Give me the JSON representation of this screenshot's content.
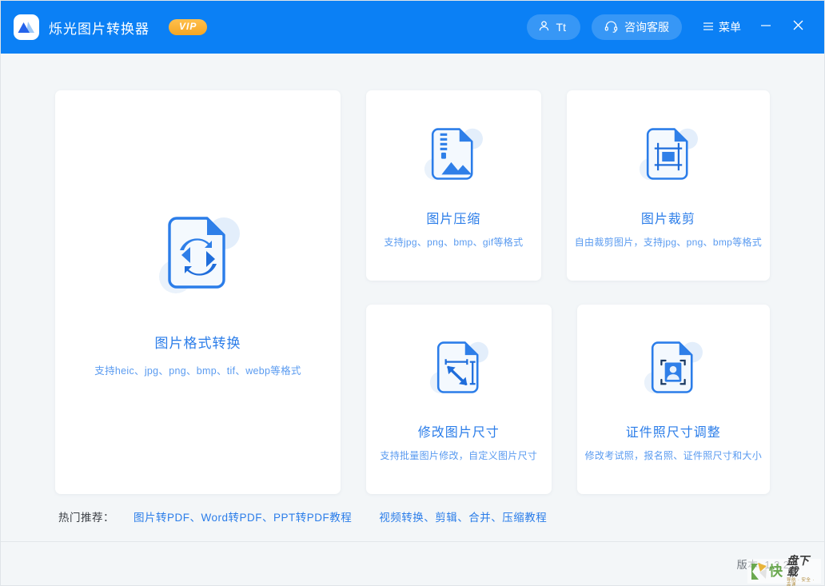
{
  "window": {
    "app_title": "烁光图片转换器",
    "badge": "VIP",
    "logo_icon": "mountain-logo-icon"
  },
  "header": {
    "user_label": "Tt",
    "user_icon": "user-icon",
    "support_label": "咨询客服",
    "support_icon": "headset-icon",
    "menu_label": "菜单",
    "menu_icon": "hamburger-icon",
    "minimize_icon": "minimize-icon",
    "close_icon": "close-icon"
  },
  "main": {
    "featured": {
      "title": "图片格式转换",
      "subtitle": "支持heic、jpg、png、bmp、tif、webp等格式",
      "icon": "image-format-convert-icon"
    },
    "cards": [
      {
        "title": "图片压缩",
        "subtitle": "支持jpg、png、bmp、gif等格式",
        "icon": "image-compress-icon"
      },
      {
        "title": "图片裁剪",
        "subtitle": "自由裁剪图片，支持jpg、png、bmp等格式",
        "icon": "image-crop-icon"
      },
      {
        "title": "修改图片尺寸",
        "subtitle": "支持批量图片修改，自定义图片尺寸",
        "icon": "image-resize-icon"
      },
      {
        "title": "证件照尺寸调整",
        "subtitle": "修改考试照，报名照、证件照尺寸和大小",
        "icon": "id-photo-icon"
      }
    ]
  },
  "recommend": {
    "label": "热门推荐：",
    "links": [
      "图片转PDF、Word转PDF、PPT转PDF教程",
      "视频转换、剪辑、合并、压缩教程"
    ]
  },
  "statusbar": {
    "version": "版本: 1.3.2.2"
  },
  "watermark": {
    "letter": "K",
    "word": "快",
    "main": "盘下载",
    "sub": "导航 · 安全 · 高速"
  },
  "colors": {
    "header_blue": "#0b80f5",
    "accent_blue": "#2b7de9",
    "sub_blue": "#5a9bf0",
    "vip_orange": "#f5a623",
    "page_bg": "#f3f6f8",
    "card_bg": "#ffffff"
  }
}
